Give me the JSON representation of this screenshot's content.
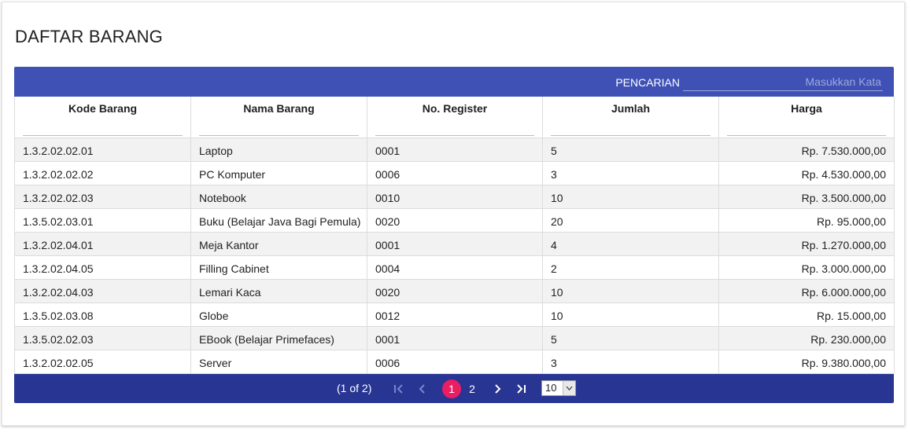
{
  "page": {
    "title": "DAFTAR BARANG"
  },
  "search": {
    "label": "PENCARIAN",
    "placeholder": "Masukkan Kata",
    "value": ""
  },
  "table": {
    "columns": [
      "Kode Barang",
      "Nama Barang",
      "No. Register",
      "Jumlah",
      "Harga"
    ],
    "rows": [
      [
        "1.3.2.02.02.01",
        "Laptop",
        "0001",
        "5",
        "Rp. 7.530.000,00"
      ],
      [
        "1.3.2.02.02.02",
        "PC Komputer",
        "0006",
        "3",
        "Rp. 4.530.000,00"
      ],
      [
        "1.3.2.02.02.03",
        "Notebook",
        "0010",
        "10",
        "Rp. 3.500.000,00"
      ],
      [
        "1.3.5.02.03.01",
        "Buku (Belajar Java Bagi Pemula)",
        "0020",
        "20",
        "Rp. 95.000,00"
      ],
      [
        "1.3.2.02.04.01",
        "Meja Kantor",
        "0001",
        "4",
        "Rp. 1.270.000,00"
      ],
      [
        "1.3.2.02.04.05",
        "Filling Cabinet",
        "0004",
        "2",
        "Rp. 3.000.000,00"
      ],
      [
        "1.3.2.02.04.03",
        "Lemari Kaca",
        "0020",
        "10",
        "Rp. 6.000.000,00"
      ],
      [
        "1.3.5.02.03.08",
        "Globe",
        "0012",
        "10",
        "Rp. 15.000,00"
      ],
      [
        "1.3.5.02.02.03",
        "EBook (Belajar Primefaces)",
        "0001",
        "5",
        "Rp. 230.000,00"
      ],
      [
        "1.3.2.02.02.05",
        "Server",
        "0006",
        "3",
        "Rp. 9.380.000,00"
      ]
    ]
  },
  "paginator": {
    "current_report": "(1 of 2)",
    "pages": [
      "1",
      "2"
    ],
    "active_page": "1",
    "rows_per_page": "10",
    "icons": {
      "first": "first-page-icon",
      "prev": "prev-page-icon",
      "next": "next-page-icon",
      "last": "last-page-icon"
    }
  },
  "colors": {
    "header_bar": "#3f51b5",
    "paginator_bar": "#283593",
    "active_page": "#e91e63"
  }
}
